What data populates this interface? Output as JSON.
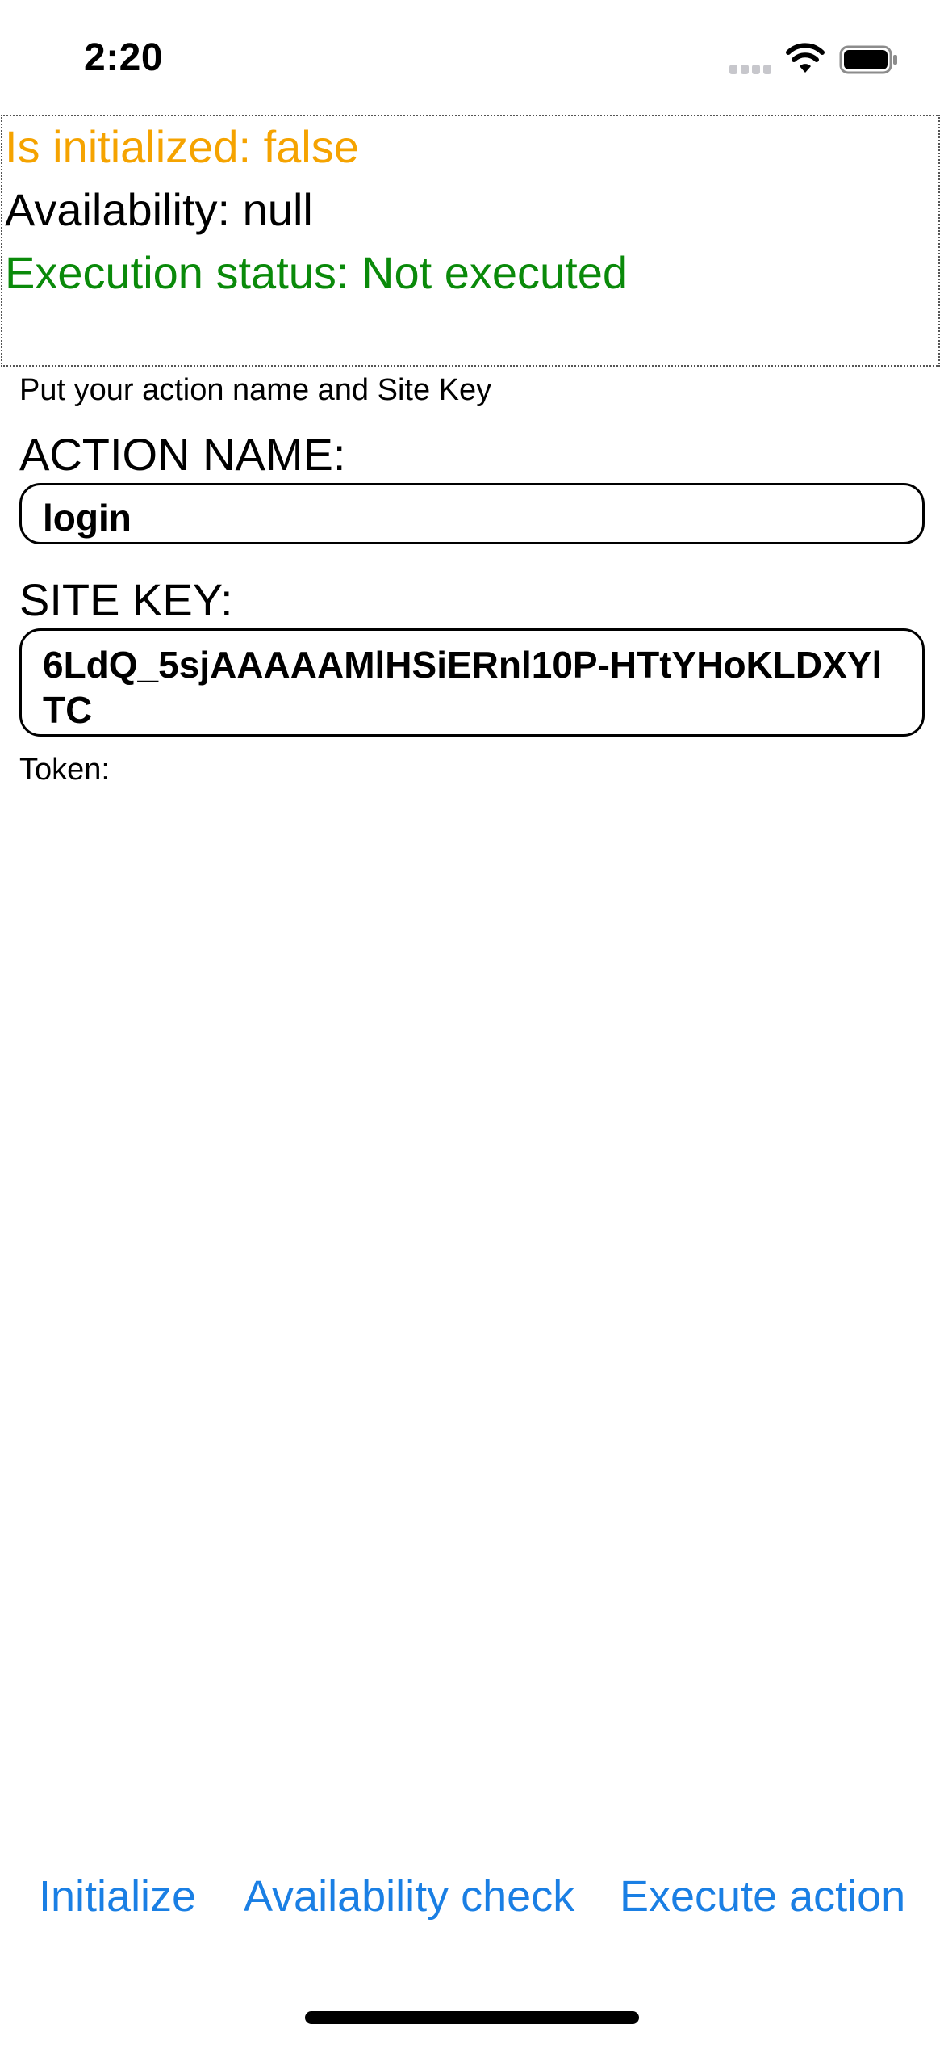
{
  "status_bar": {
    "time": "2:20",
    "icons": [
      "cellular-signal-icon",
      "wifi-icon",
      "battery-icon"
    ]
  },
  "status_panel": {
    "initialized_text": "Is initialized: false",
    "availability_text": "Availability: null",
    "execution_text": "Execution status: Not executed",
    "colors": {
      "initialized": "#f5a300",
      "availability": "#000000",
      "execution": "#0a8a0a"
    }
  },
  "form": {
    "hint": "Put your action name and Site Key",
    "action_name_label": "ACTION NAME:",
    "action_name_value": "login",
    "site_key_label": "SITE KEY:",
    "site_key_value": "6LdQ_5sjAAAAAMlHSiERnl10P-HTtYHoKLDXYlTC",
    "token_label": "Token:"
  },
  "actions": {
    "initialize": "Initialize",
    "availability_check": "Availability check",
    "execute_action": "Execute action",
    "accent_color": "#1a7fe4"
  }
}
